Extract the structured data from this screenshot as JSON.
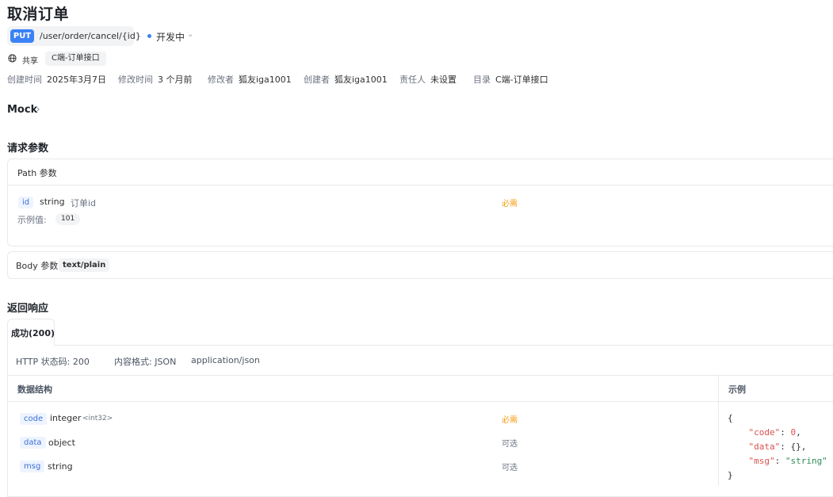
{
  "header": {
    "title": "取消订单",
    "method": "PUT",
    "path": "/user/order/cancel/{id}",
    "status": "开发中",
    "share_label": "共享",
    "folder_tag": "C端-订单接口"
  },
  "meta": {
    "created_label": "创建时间",
    "created_value": "2025年3月7日",
    "modified_label": "修改时间",
    "modified_value": "3 个月前",
    "modifier_label": "修改者",
    "modifier_value": "狐友iga1001",
    "creator_label": "创建者",
    "creator_value": "狐友iga1001",
    "owner_label": "责任人",
    "owner_value": "未设置",
    "dir_label": "目录",
    "dir_value": "C端-订单接口"
  },
  "mock": {
    "label": "Mock"
  },
  "request": {
    "title": "请求参数",
    "path_section": "Path 参数",
    "path_params": [
      {
        "name": "id",
        "type": "string",
        "desc": "订单id",
        "required": "必需",
        "example_label": "示例值:",
        "example": "101"
      }
    ],
    "body_section": "Body 参数",
    "body_type": "text/plain"
  },
  "response": {
    "title": "返回响应",
    "tab_label": "成功(200)",
    "http_status": "HTTP 状态码: 200",
    "content_format": "内容格式: JSON",
    "content_type": "application/json",
    "schema_header": "数据结构",
    "example_header": "示例",
    "fields": [
      {
        "name": "code",
        "type": "integer",
        "subtype": "<int32>",
        "required": "必需"
      },
      {
        "name": "data",
        "type": "object",
        "subtype": "",
        "required": "可选"
      },
      {
        "name": "msg",
        "type": "string",
        "subtype": "",
        "required": "可选"
      }
    ],
    "example_lines": {
      "open": "{",
      "code_key": "\"code\"",
      "code_val": "0",
      "data_key": "\"data\"",
      "data_val": "{}",
      "msg_key": "\"msg\"",
      "msg_val": "\"string\"",
      "close": "}"
    }
  },
  "colors": {
    "accent": "#3b82f6",
    "required": "#f39c12"
  },
  "icons": [
    "globe-icon",
    "chevron-down-icon",
    "chevron-right-icon"
  ]
}
